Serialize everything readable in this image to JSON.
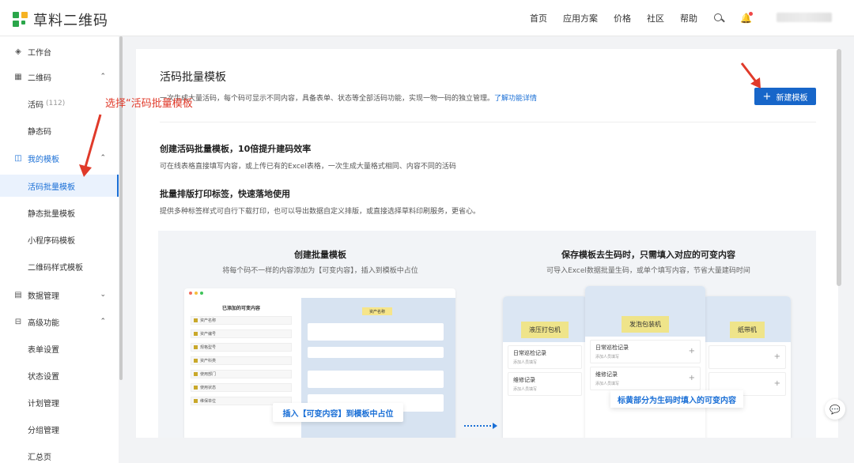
{
  "brand": {
    "name": "草料二维码"
  },
  "topnav": {
    "items": [
      "首页",
      "应用方案",
      "价格",
      "社区",
      "帮助"
    ],
    "search_icon": "search-icon",
    "bell_icon": "bell-icon"
  },
  "sidebar": {
    "items": [
      {
        "label": "工作台",
        "icon": "dashboard-icon"
      },
      {
        "label": "二维码",
        "icon": "qr-icon",
        "chevron": "⌃"
      },
      {
        "label": "活码",
        "count": "(112)"
      },
      {
        "label": "静态码"
      },
      {
        "label": "我的模板",
        "icon": "template-icon",
        "chevron": "⌃"
      },
      {
        "label": "活码批量模板"
      },
      {
        "label": "静态批量模板"
      },
      {
        "label": "小程序码模板"
      },
      {
        "label": "二维码样式模板"
      },
      {
        "label": "数据管理",
        "icon": "data-icon",
        "chevron": "⌄"
      },
      {
        "label": "高级功能",
        "icon": "advanced-icon",
        "chevron": "⌃"
      },
      {
        "label": "表单设置"
      },
      {
        "label": "状态设置"
      },
      {
        "label": "计划管理"
      },
      {
        "label": "分组管理"
      },
      {
        "label": "汇总页"
      }
    ]
  },
  "main": {
    "title": "活码批量模板",
    "desc": "一次生成大量活码，每个码可显示不同内容，具备表单、状态等全部活码功能，实现一物一码的独立管理。",
    "desc_link": "了解功能详情",
    "new_button": "新建模板",
    "section1_title": "创建活码批量模板，10倍提升建码效率",
    "section1_desc": "可在线表格直接填写内容，或上传已有的Excel表格，一次生成大量格式相同、内容不同的活码",
    "section2_title": "批量排版打印标签，快速落地使用",
    "section2_desc": "提供多种标签样式可自行下载打印，也可以导出数据自定义排版，或直接选择草料印刷服务，更省心。"
  },
  "illustration": {
    "left_title": "创建批量模板",
    "left_sub": "将每个码不一样的内容添加为【可变内容】，插入到模板中占位",
    "right_title": "保存模板去生码时，只需填入对应的可变内容",
    "right_sub": "可导入Excel数据批量生码，或单个填写内容，节省大量建码时间",
    "insert_tip": "插入【可变内容】到模板中占位",
    "mark_tip": "标黄部分为生码时填入的可变内容",
    "mock_left_title": "已添加的可变内容",
    "mock_left_rows": [
      "资产名称",
      "资产编号",
      "规格型号",
      "资产科类",
      "使用部门",
      "使用状态",
      "维保单位"
    ],
    "mock_right_tag": "资产名称",
    "phones": [
      {
        "name": "液压打包机",
        "rec1": "日常巡检记录",
        "rec2": "维修记录"
      },
      {
        "name": "发泡包装机",
        "rec1": "日常巡检记录",
        "rec2": "维修记录"
      },
      {
        "name": "纸带机",
        "rec1": "",
        "rec2": ""
      }
    ],
    "rec_hint": "添加人员填写"
  },
  "annotation": {
    "text": "选择“活码批量模板"
  },
  "colors": {
    "accent": "#1766c9",
    "annotation": "#e03a2a",
    "highlight": "#f6e58a"
  }
}
